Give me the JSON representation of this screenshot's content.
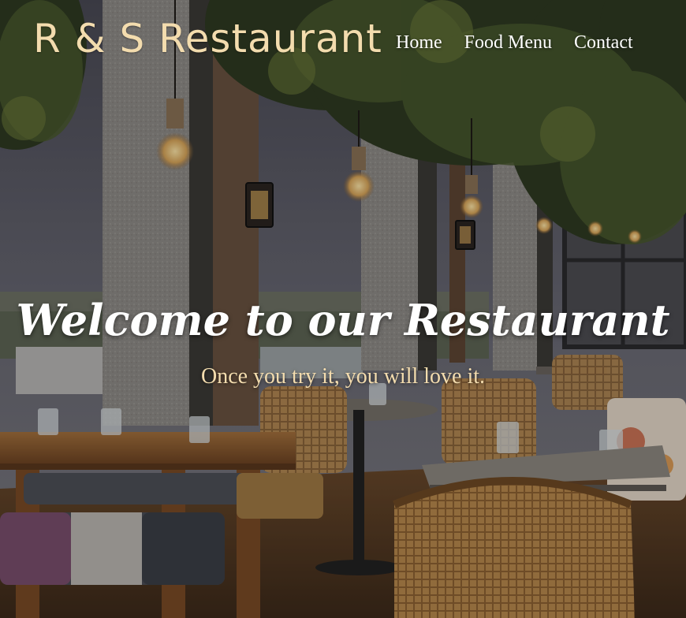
{
  "brand": {
    "name": "R & S Restaurant"
  },
  "nav": {
    "items": [
      {
        "label": "Home"
      },
      {
        "label": "Food Menu"
      },
      {
        "label": "Contact"
      }
    ]
  },
  "hero": {
    "title": "Welcome to our Restaurant",
    "subtitle": "Once you try it, you will love it.",
    "background_image": "restaurant-interior-photo"
  },
  "colors": {
    "brand_accent": "#f3dcae",
    "nav_text": "#ffffff",
    "title_text": "#ffffff"
  }
}
